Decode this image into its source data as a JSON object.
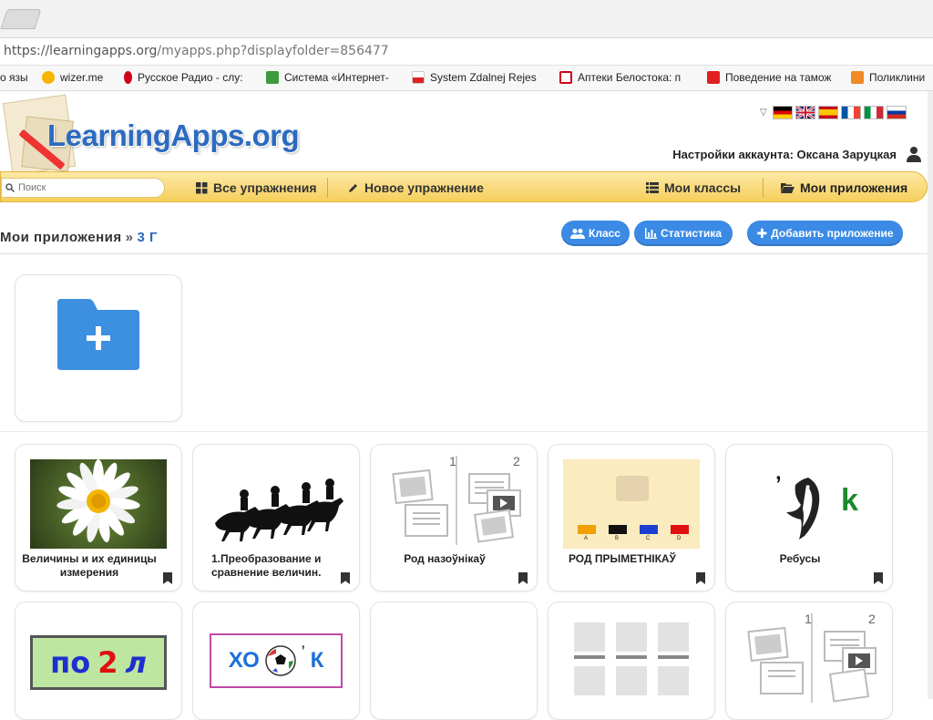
{
  "browser": {
    "url_main": "https://learningapps.org",
    "url_rest": "/myapps.php?displayfolder=856477",
    "bookmarks": [
      {
        "label": "о язы",
        "color": "#888888"
      },
      {
        "label": "wizer.me",
        "color": "#f7b500"
      },
      {
        "label": "Русское Радио - слу:",
        "color": "#d0021b"
      },
      {
        "label": "Система «Интернет-",
        "color": "#3d9a3d"
      },
      {
        "label": "System Zdalnej Rejes",
        "color": "#e02020"
      },
      {
        "label": "Аптеки Белостока: п",
        "color": "#d0021b"
      },
      {
        "label": "Поведение на тамож",
        "color": "#e02020"
      },
      {
        "label": "Поликлини",
        "color": "#f08a24"
      }
    ]
  },
  "header": {
    "logo": "LearningApps.org",
    "account": "Настройки аккаунта: Оксана Заруцкая",
    "flags": [
      "de",
      "gb",
      "es",
      "fr",
      "it",
      "ru"
    ]
  },
  "nav": {
    "search_placeholder": "Поиск",
    "all_exercises": "Все упражнения",
    "new_exercise": "Новое упражнение",
    "my_classes": "Мои классы",
    "my_apps": "Мои приложения"
  },
  "crumb": {
    "root": "Мои приложения",
    "separator": "»",
    "current": "3 Г"
  },
  "actions": {
    "class_label": "Класс",
    "stats_label": "Статистика",
    "add_label": "Добавить приложение",
    "accent": "#3b8be6"
  },
  "folder_card": {
    "icon": "folder-plus-icon"
  },
  "apps": [
    {
      "label": "Величины и их единицы измерения",
      "thumb": "daisy-photo"
    },
    {
      "label": "1.Преобразование и сравнение величин.",
      "thumb": "horse-race"
    },
    {
      "label": "Род назоўнікаў",
      "thumb": "columns-template",
      "num1": "1",
      "num2": "2"
    },
    {
      "label": "РОД ПРЫМЕТНІКАЎ",
      "thumb": "color-classes",
      "tags": [
        "A",
        "B",
        "C",
        "D"
      ]
    },
    {
      "label": "Ребусы",
      "thumb": "rebus-shark",
      "glyph_apos": "’",
      "glyph_k": "k"
    },
    {
      "label": "",
      "thumb": "rebus-po2l",
      "word1": "по",
      "word2": "2",
      "word3": "л"
    },
    {
      "label": "",
      "thumb": "rebus-ball",
      "word1": "ХО",
      "word2": "’",
      "word3": "К"
    },
    {
      "label": "",
      "thumb": "blank"
    },
    {
      "label": "",
      "thumb": "grid-template"
    },
    {
      "label": "",
      "thumb": "columns-template",
      "num1": "1",
      "num2": "2"
    }
  ]
}
